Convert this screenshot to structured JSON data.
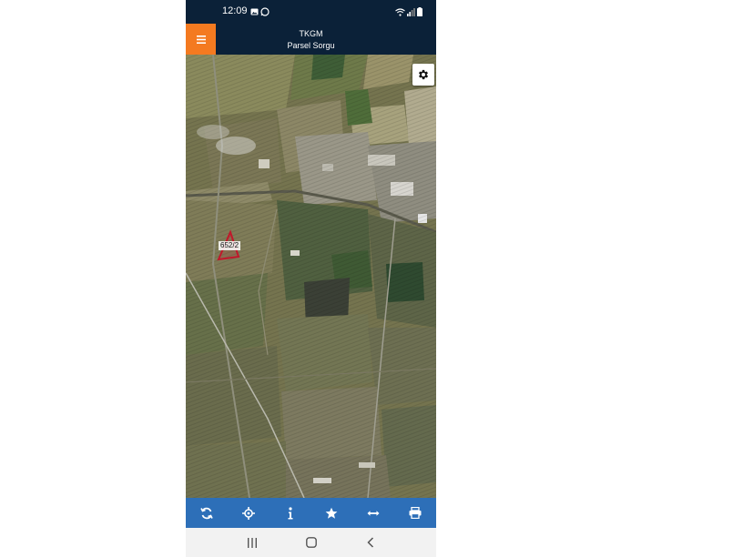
{
  "status_bar": {
    "time": "12:09",
    "left_icons": [
      "image-icon",
      "whatsapp-icon"
    ],
    "right_icons": [
      "wifi-icon",
      "signal-icon",
      "battery-icon"
    ]
  },
  "header": {
    "menu_icon": "hamburger-menu-icon",
    "title": "TKGM",
    "subtitle": "Parsel Sorgu",
    "menu_color": "#f47a20",
    "bar_color": "#0b2138"
  },
  "map": {
    "parcel_label": "652/2",
    "parcel_outline_color": "#c0182b",
    "settings_icon": "gear-icon"
  },
  "toolbar": {
    "color": "#2d6fb8",
    "buttons": [
      {
        "icon": "refresh-icon"
      },
      {
        "icon": "locate-icon"
      },
      {
        "icon": "info-icon"
      },
      {
        "icon": "star-icon"
      },
      {
        "icon": "measure-icon"
      },
      {
        "icon": "print-icon"
      }
    ]
  },
  "nav": {
    "buttons": [
      "recent-apps-icon",
      "home-icon",
      "back-icon"
    ]
  }
}
